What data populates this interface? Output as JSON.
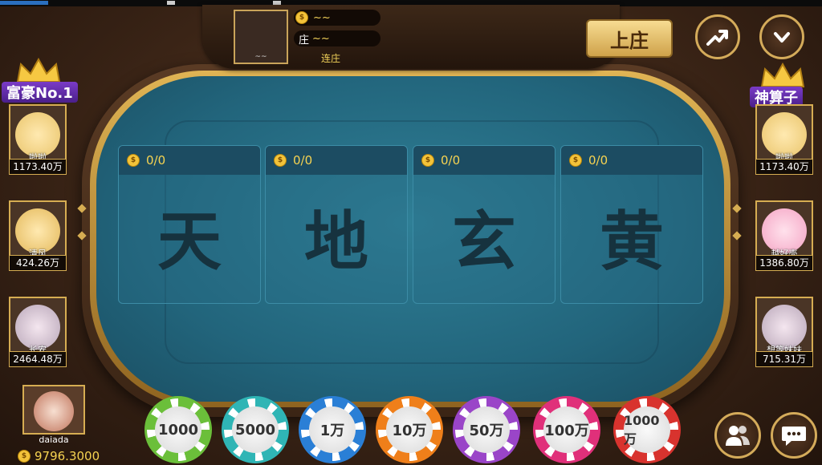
{
  "banker": {
    "avatar_tag": "~~",
    "coins": "~~",
    "name_label": "庄",
    "name_value": "~~",
    "streak_label": "连庄"
  },
  "buttons": {
    "become_banker": "上庄"
  },
  "bet_areas": [
    {
      "amount": "0/0",
      "label": "天"
    },
    {
      "amount": "0/0",
      "label": "地"
    },
    {
      "amount": "0/0",
      "label": "玄"
    },
    {
      "amount": "0/0",
      "label": "黄"
    }
  ],
  "left_rank_title": "富豪No.1",
  "right_rank_title": "神算子",
  "left_players": [
    {
      "name": "啦啦",
      "score": "1173.40万"
    },
    {
      "name": "清风",
      "score": "424.26万"
    },
    {
      "name": "长安",
      "score": "2464.48万"
    }
  ],
  "right_players": [
    {
      "name": "啦啦",
      "score": "1173.40万"
    },
    {
      "name": "越好壳",
      "score": "1386.80万"
    },
    {
      "name": "想等妹妹",
      "score": "715.31万"
    }
  ],
  "me": {
    "name": "daiada",
    "score": "9796.3000"
  },
  "chips": [
    {
      "label": "1000",
      "color": "#6bbf3a"
    },
    {
      "label": "5000",
      "color": "#2fb5b5"
    },
    {
      "label": "1万",
      "color": "#2a7fd6"
    },
    {
      "label": "10万",
      "color": "#ef7f1a"
    },
    {
      "label": "50万",
      "color": "#9a45c8"
    },
    {
      "label": "100万",
      "color": "#e0307a"
    },
    {
      "label": "1000万",
      "color": "#d8332e"
    }
  ],
  "icons": {
    "trend": "trend-up-icon",
    "dropdown": "chevron-down-icon",
    "players": "players-icon",
    "chat": "chat-bubble-icon"
  }
}
